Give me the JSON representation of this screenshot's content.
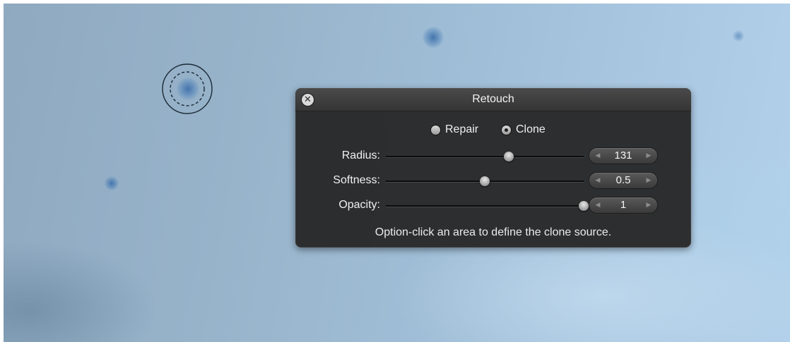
{
  "hud": {
    "title": "Retouch",
    "close_icon": "close-circle-icon",
    "mode": {
      "options": [
        {
          "label": "Repair",
          "selected": false
        },
        {
          "label": "Clone",
          "selected": true
        }
      ]
    },
    "sliders": [
      {
        "label": "Radius:",
        "value": "131",
        "fraction": 0.62
      },
      {
        "label": "Softness:",
        "value": "0.5",
        "fraction": 0.5
      },
      {
        "label": "Opacity:",
        "value": "1",
        "fraction": 1.0
      }
    ],
    "hint": "Option-click an area to define the clone source."
  },
  "canvas": {
    "brush_icon": "clone-brush-cursor-icon"
  }
}
